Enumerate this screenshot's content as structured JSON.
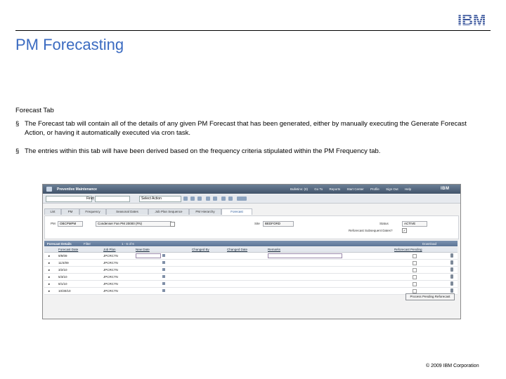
{
  "slide": {
    "title": "PM Forecasting",
    "section_label": "Forecast Tab",
    "bullets": [
      "The Forecast tab will contain all of the details of any given PM Forecast that has been generated, either by manually executing the Generate Forecast Action, or having it automatically executed via cron task.",
      "The entries within this tab will have been derived based on the frequency criteria stipulated within the PM Frequency tab."
    ],
    "bullet_mark": "§",
    "copyright": "© 2009 IBM Corporation",
    "logo_text": "IBM"
  },
  "app": {
    "name": "Preventive Maintenance",
    "nav_links": [
      "Bulletins: (0)",
      "Go To",
      "Reports",
      "Start Center",
      "Profile",
      "Sign Out",
      "Help"
    ],
    "brand": "IBM",
    "toolbar": {
      "find_label": "Find:",
      "select_action": "Select Action"
    },
    "tabs": [
      "List",
      "PM",
      "Frequency",
      "Seasonal Dates",
      "Job Plan Sequence",
      "PM Hierarchy",
      "Forecast"
    ],
    "active_tab": "Forecast",
    "form": {
      "pm_label": "PM",
      "pm_value": "OBCPMPM",
      "pm_desc": "Condenser Fan PM 20000 (FN)",
      "site_label": "Site",
      "site_value": "BEDFORD",
      "status_label": "Status",
      "status_value": "ACTIVE",
      "reforecast_label": "Reforecast Subsequent Dates?",
      "reforecast_checked": "✓"
    },
    "grid": {
      "title": "Forecast Details",
      "filter": "Filter",
      "paging": "1 - 6 of 6",
      "download": "Download",
      "columns": [
        "Forecast Date",
        "Job Plan",
        "New Date",
        "Changed By",
        "Changed Date",
        "Remarks",
        "Reforecast Pending"
      ],
      "rows": [
        {
          "date": "9/9/09",
          "job_plan": "JPCRC7N"
        },
        {
          "date": "11/4/09",
          "job_plan": "JPCRC7N"
        },
        {
          "date": "3/2/10",
          "job_plan": "JPCRC7N"
        },
        {
          "date": "5/3/10",
          "job_plan": "JPCRC7N"
        },
        {
          "date": "8/1/10",
          "job_plan": "JPCRC7N"
        },
        {
          "date": "10/30/10",
          "job_plan": "JPCRC7N"
        }
      ],
      "row_arrow": "▸",
      "process_button": "Process Pending Reforecast"
    }
  }
}
